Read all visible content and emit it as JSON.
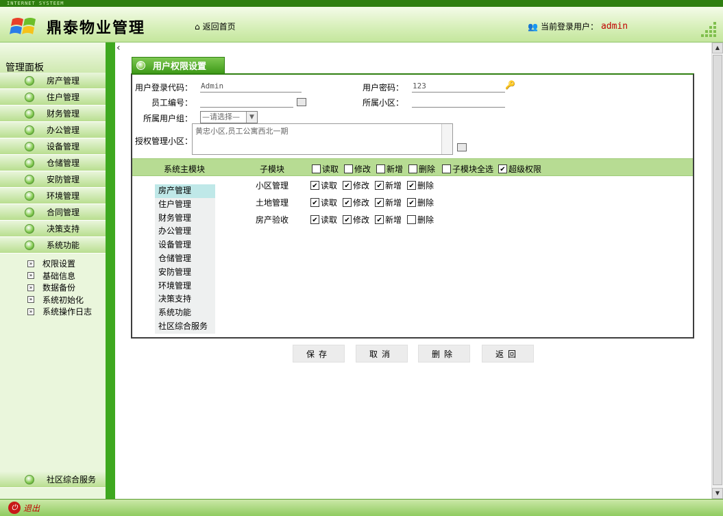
{
  "topstrip": {
    "text": "INTERNET SYSTEEM"
  },
  "header": {
    "brand": "鼎泰物业管理",
    "home_link": "返回首页",
    "user_label": "当前登录用户：",
    "user_name": "admin"
  },
  "sidebar": {
    "title": "管理面板",
    "items": [
      {
        "label": "房产管理"
      },
      {
        "label": "住户管理"
      },
      {
        "label": "财务管理"
      },
      {
        "label": "办公管理"
      },
      {
        "label": "设备管理"
      },
      {
        "label": "仓储管理"
      },
      {
        "label": "安防管理"
      },
      {
        "label": "环境管理"
      },
      {
        "label": "合同管理"
      },
      {
        "label": "决策支持"
      },
      {
        "label": "系统功能"
      }
    ],
    "subitems": [
      {
        "label": "权限设置"
      },
      {
        "label": "基础信息"
      },
      {
        "label": "数据备份"
      },
      {
        "label": "系统初始化"
      },
      {
        "label": "系统操作日志"
      }
    ],
    "bottom_item": "社区综合服务"
  },
  "footer": {
    "logout": "退出"
  },
  "form": {
    "tab_title": "用户权限设置",
    "login_code_label": "用户登录代码：",
    "login_code_value": "Admin",
    "password_label": "用户密码：",
    "password_value": "123",
    "employee_no_label": "员工编号：",
    "community_label": "所属小区：",
    "group_label": "所属用户组：",
    "group_select": "—请选择—",
    "auth_area_label": "授权管理小区：",
    "auth_area_value": "黄忠小区,员工公寓西北一期"
  },
  "permissions": {
    "main_module_header": "系统主模块",
    "sub_module_header": "子模块",
    "header_checks": [
      {
        "label": "读取",
        "checked": false
      },
      {
        "label": "修改",
        "checked": false
      },
      {
        "label": "新增",
        "checked": false
      },
      {
        "label": "删除",
        "checked": false
      },
      {
        "label": "子模块全选",
        "checked": false
      },
      {
        "label": "超级权限",
        "checked": true
      }
    ],
    "modules": [
      {
        "label": "房产管理",
        "active": true
      },
      {
        "label": "住户管理"
      },
      {
        "label": "财务管理"
      },
      {
        "label": "办公管理"
      },
      {
        "label": "设备管理"
      },
      {
        "label": "仓储管理"
      },
      {
        "label": "安防管理"
      },
      {
        "label": "环境管理"
      },
      {
        "label": "决策支持"
      },
      {
        "label": "系统功能"
      },
      {
        "label": "社区综合服务"
      }
    ],
    "sub_rows": [
      {
        "name": "小区管理",
        "perms": [
          {
            "label": "读取",
            "checked": true
          },
          {
            "label": "修改",
            "checked": true
          },
          {
            "label": "新增",
            "checked": true
          },
          {
            "label": "删除",
            "checked": true
          }
        ]
      },
      {
        "name": "土地管理",
        "perms": [
          {
            "label": "读取",
            "checked": true
          },
          {
            "label": "修改",
            "checked": true
          },
          {
            "label": "新增",
            "checked": true
          },
          {
            "label": "删除",
            "checked": true
          }
        ]
      },
      {
        "name": "房产验收",
        "perms": [
          {
            "label": "读取",
            "checked": true
          },
          {
            "label": "修改",
            "checked": true
          },
          {
            "label": "新增",
            "checked": true
          },
          {
            "label": "删除",
            "checked": false
          }
        ]
      }
    ]
  },
  "buttons": {
    "save": "保存",
    "cancel": "取消",
    "delete": "删除",
    "back": "返回"
  },
  "colors": {
    "accent_green": "#3ea81f",
    "user_red": "#c00000"
  }
}
